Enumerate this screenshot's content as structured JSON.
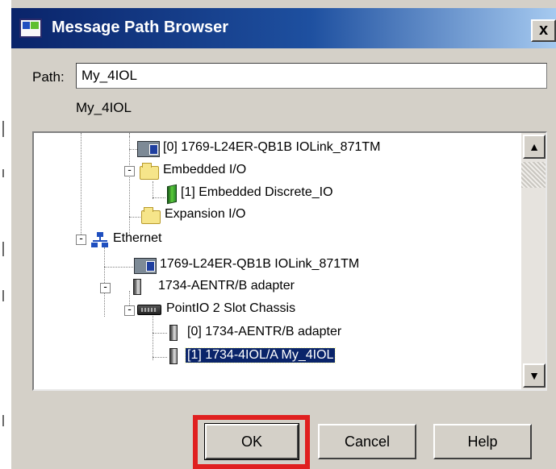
{
  "window": {
    "title": "Message Path Browser",
    "close_label": "x"
  },
  "path": {
    "label": "Path:",
    "value": "My_4IOL",
    "resolved_text": "My_4IOL"
  },
  "tree": {
    "items": [
      {
        "label": "[0] 1769-L24ER-QB1B IOLink_871TM",
        "icon": "controller-icon"
      },
      {
        "label": "Embedded I/O",
        "icon": "folder-open-icon",
        "expander": "-"
      },
      {
        "label": "[1] Embedded Discrete_IO",
        "icon": "io-module-icon"
      },
      {
        "label": "Expansion I/O",
        "icon": "folder-icon"
      },
      {
        "label": "Ethernet",
        "icon": "network-icon",
        "expander": "-"
      },
      {
        "label": "1769-L24ER-QB1B IOLink_871TM",
        "icon": "controller-icon"
      },
      {
        "label": "1734-AENTR/B adapter",
        "icon": "module-icon",
        "expander": "-"
      },
      {
        "label": "PointIO 2 Slot Chassis",
        "icon": "chassis-icon",
        "expander": "-"
      },
      {
        "label": "[0] 1734-AENTR/B adapter",
        "icon": "module-icon"
      },
      {
        "label": "[1] 1734-4IOL/A My_4IOL",
        "icon": "module-icon",
        "selected": true
      }
    ],
    "scroll_up": "▲",
    "scroll_down": "▼"
  },
  "buttons": {
    "ok": "OK",
    "cancel": "Cancel",
    "help": "Help"
  },
  "colors": {
    "selection": "#0a246a",
    "annotation_highlight": "#e02020"
  }
}
